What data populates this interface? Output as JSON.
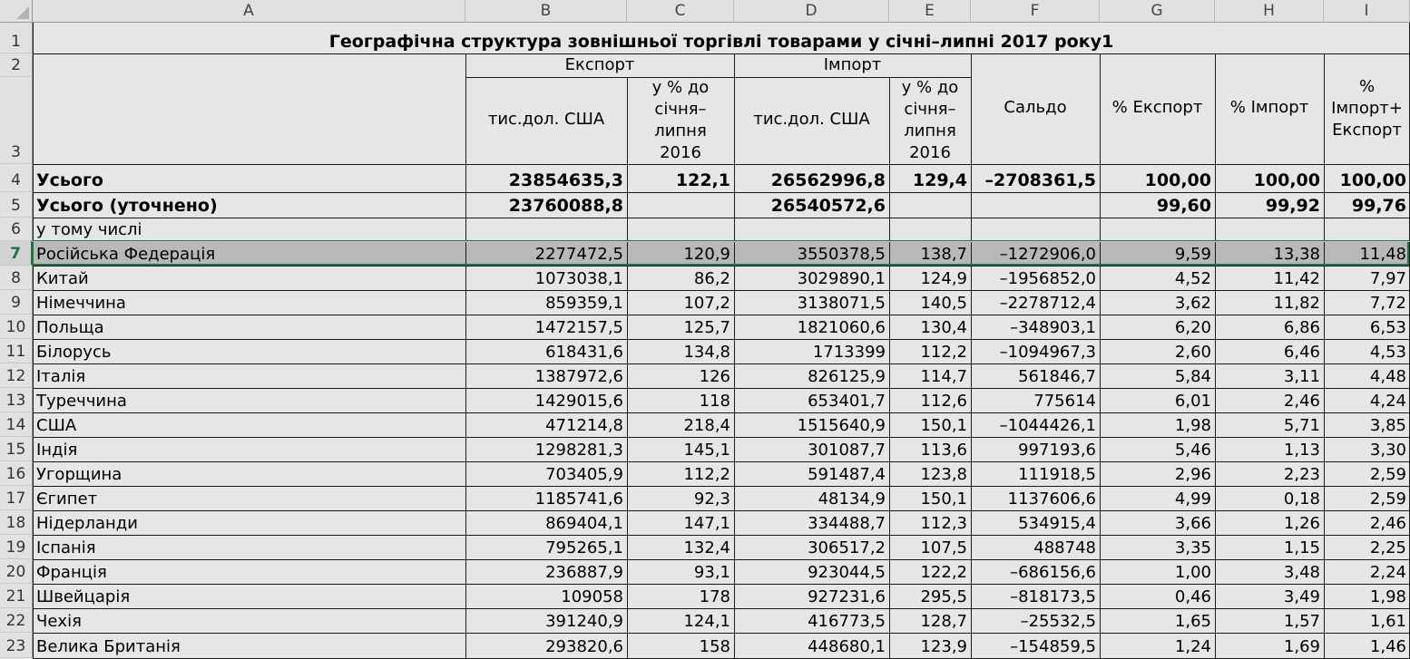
{
  "columns": [
    "A",
    "B",
    "C",
    "D",
    "E",
    "F",
    "G",
    "H",
    "I"
  ],
  "title": "Географічна структура зовнішньої торгівлі товарами у січні–липні 2017 року1",
  "headers": {
    "export": "Експорт",
    "import": "Імпорт",
    "export_usd": "тис.дол. США",
    "export_pct": "у % до січня–липня 2016",
    "import_usd": "тис.дол. США",
    "import_pct": "у % до січня–липня 2016",
    "saldo": "Сальдо",
    "pct_export": "% Експорт",
    "pct_import": "% Імпорт",
    "pct_total": "% Імпорт+ Експорт"
  },
  "rows": [
    {
      "n": "4",
      "name": "Усього",
      "b": "23854635,3",
      "c": "122,1",
      "d": "26562996,8",
      "e": "129,4",
      "f": "–2708361,5",
      "g": "100,00",
      "h": "100,00",
      "i": "100,00"
    },
    {
      "n": "5",
      "name": "Усього (уточнено)",
      "b": "23760088,8",
      "c": "",
      "d": "26540572,6",
      "e": "",
      "f": "",
      "g": "99,60",
      "h": "99,92",
      "i": "99,76"
    },
    {
      "n": "6",
      "name": "у тому числі",
      "b": "",
      "c": "",
      "d": "",
      "e": "",
      "f": "",
      "g": "",
      "h": "",
      "i": ""
    },
    {
      "n": "7",
      "name": "Російська Федерація",
      "b": "2277472,5",
      "c": "120,9",
      "d": "3550378,5",
      "e": "138,7",
      "f": "–1272906,0",
      "g": "9,59",
      "h": "13,38",
      "i": "11,48"
    },
    {
      "n": "8",
      "name": "Китай",
      "b": "1073038,1",
      "c": "86,2",
      "d": "3029890,1",
      "e": "124,9",
      "f": "–1956852,0",
      "g": "4,52",
      "h": "11,42",
      "i": "7,97"
    },
    {
      "n": "9",
      "name": "Німеччина",
      "b": "859359,1",
      "c": "107,2",
      "d": "3138071,5",
      "e": "140,5",
      "f": "–2278712,4",
      "g": "3,62",
      "h": "11,82",
      "i": "7,72"
    },
    {
      "n": "10",
      "name": "Польща",
      "b": "1472157,5",
      "c": "125,7",
      "d": "1821060,6",
      "e": "130,4",
      "f": "–348903,1",
      "g": "6,20",
      "h": "6,86",
      "i": "6,53"
    },
    {
      "n": "11",
      "name": "Білорусь",
      "b": "618431,6",
      "c": "134,8",
      "d": "1713399",
      "e": "112,2",
      "f": "–1094967,3",
      "g": "2,60",
      "h": "6,46",
      "i": "4,53"
    },
    {
      "n": "12",
      "name": "Італія",
      "b": "1387972,6",
      "c": "126",
      "d": "826125,9",
      "e": "114,7",
      "f": "561846,7",
      "g": "5,84",
      "h": "3,11",
      "i": "4,48"
    },
    {
      "n": "13",
      "name": "Туреччина",
      "b": "1429015,6",
      "c": "118",
      "d": "653401,7",
      "e": "112,6",
      "f": "775614",
      "g": "6,01",
      "h": "2,46",
      "i": "4,24"
    },
    {
      "n": "14",
      "name": "США",
      "b": "471214,8",
      "c": "218,4",
      "d": "1515640,9",
      "e": "150,1",
      "f": "–1044426,1",
      "g": "1,98",
      "h": "5,71",
      "i": "3,85"
    },
    {
      "n": "15",
      "name": "Індія",
      "b": "1298281,3",
      "c": "145,1",
      "d": "301087,7",
      "e": "113,6",
      "f": "997193,6",
      "g": "5,46",
      "h": "1,13",
      "i": "3,30"
    },
    {
      "n": "16",
      "name": "Угорщина",
      "b": "703405,9",
      "c": "112,2",
      "d": "591487,4",
      "e": "123,8",
      "f": "111918,5",
      "g": "2,96",
      "h": "2,23",
      "i": "2,59"
    },
    {
      "n": "17",
      "name": "Єгипет",
      "b": "1185741,6",
      "c": "92,3",
      "d": "48134,9",
      "e": "150,1",
      "f": "1137606,6",
      "g": "4,99",
      "h": "0,18",
      "i": "2,59"
    },
    {
      "n": "18",
      "name": "Нідерланди",
      "b": "869404,1",
      "c": "147,1",
      "d": "334488,7",
      "e": "112,3",
      "f": "534915,4",
      "g": "3,66",
      "h": "1,26",
      "i": "2,46"
    },
    {
      "n": "19",
      "name": "Іспанія",
      "b": "795265,1",
      "c": "132,4",
      "d": "306517,2",
      "e": "107,5",
      "f": "488748",
      "g": "3,35",
      "h": "1,15",
      "i": "2,25"
    },
    {
      "n": "20",
      "name": "Франція",
      "b": "236887,9",
      "c": "93,1",
      "d": "923044,5",
      "e": "122,2",
      "f": "–686156,6",
      "g": "1,00",
      "h": "3,48",
      "i": "2,24"
    },
    {
      "n": "21",
      "name": "Швейцарія",
      "b": "109058",
      "c": "178",
      "d": "927231,6",
      "e": "295,5",
      "f": "–818173,5",
      "g": "0,46",
      "h": "3,49",
      "i": "1,98"
    },
    {
      "n": "22",
      "name": "Чехія",
      "b": "391240,9",
      "c": "124,1",
      "d": "416773,5",
      "e": "128,7",
      "f": "–25532,5",
      "g": "1,65",
      "h": "1,57",
      "i": "1,61"
    },
    {
      "n": "23",
      "name": "Велика Британія",
      "b": "293820,6",
      "c": "158",
      "d": "448680,1",
      "e": "123,9",
      "f": "–154859,5",
      "g": "1,24",
      "h": "1,69",
      "i": "1,46"
    }
  ]
}
